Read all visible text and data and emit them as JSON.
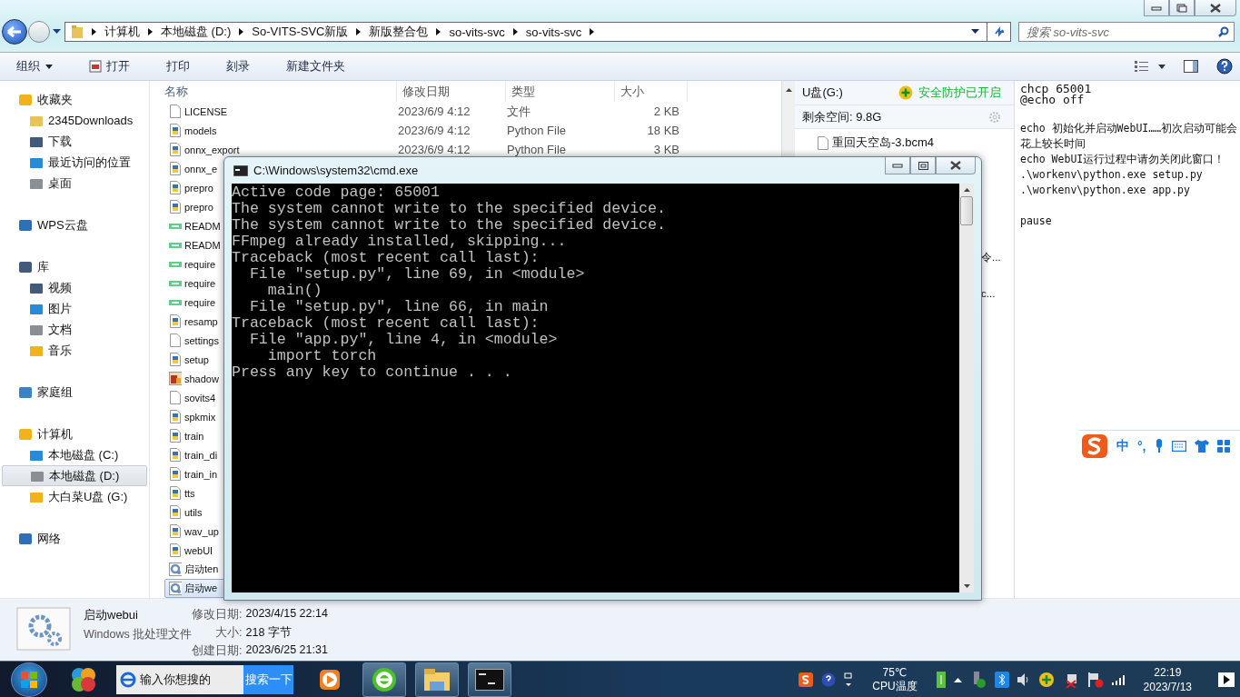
{
  "address_bar": {
    "crumbs": [
      "计算机",
      "本地磁盘 (D:)",
      "So-VITS-SVC新版",
      "新版整合包",
      "so-vits-svc",
      "so-vits-svc"
    ]
  },
  "search": {
    "placeholder": "搜索 so-vits-svc"
  },
  "toolbar": {
    "items": [
      {
        "label": "组织",
        "kind": "menu"
      },
      {
        "label": "打开",
        "kind": "icon"
      },
      {
        "label": "打印",
        "kind": "plain"
      },
      {
        "label": "刻录",
        "kind": "plain"
      },
      {
        "label": "新建文件夹",
        "kind": "plain"
      }
    ]
  },
  "nav": {
    "groups": [
      {
        "label": "收藏夹",
        "selected": false,
        "children": [
          {
            "label": "2345Downloads",
            "selected": false
          },
          {
            "label": "下载",
            "selected": false
          },
          {
            "label": "最近访问的位置",
            "selected": false
          },
          {
            "label": "桌面",
            "selected": false
          }
        ]
      },
      {
        "label": "WPS云盘",
        "selected": false
      },
      {
        "label": "库",
        "selected": false,
        "children": [
          {
            "label": "视频",
            "selected": false
          },
          {
            "label": "图片",
            "selected": false
          },
          {
            "label": "文档",
            "selected": false
          },
          {
            "label": "音乐",
            "selected": false
          }
        ]
      },
      {
        "label": "家庭组",
        "selected": false
      },
      {
        "label": "计算机",
        "selected": false,
        "children": [
          {
            "label": "本地磁盘 (C:)",
            "selected": false
          },
          {
            "label": "本地磁盘 (D:)",
            "selected": true
          },
          {
            "label": "大白菜U盘 (G:)",
            "selected": false
          }
        ]
      },
      {
        "label": "网络",
        "selected": false
      }
    ]
  },
  "file_list": {
    "columns": [
      "名称",
      "修改日期",
      "类型",
      "大小"
    ],
    "rows": [
      {
        "name": "LICENSE",
        "date": "2023/6/9 4:12",
        "type": "文件",
        "size": "2 KB",
        "kind": "blank",
        "selected": false
      },
      {
        "name": "models",
        "date": "2023/6/9 4:12",
        "type": "Python File",
        "size": "18 KB",
        "kind": "python",
        "selected": false
      },
      {
        "name": "onnx_export",
        "date": "2023/6/9 4:12",
        "type": "Python File",
        "size": "3 KB",
        "kind": "python",
        "selected": false
      },
      {
        "name": "onnx_e",
        "kind": "python",
        "selected": false
      },
      {
        "name": "prepro",
        "kind": "python",
        "selected": false
      },
      {
        "name": "prepro",
        "kind": "python",
        "selected": false
      },
      {
        "name": "READM",
        "kind": "text",
        "selected": false
      },
      {
        "name": "READM",
        "kind": "text",
        "selected": false
      },
      {
        "name": "require",
        "kind": "text",
        "selected": false
      },
      {
        "name": "require",
        "kind": "text",
        "selected": false
      },
      {
        "name": "require",
        "kind": "text",
        "selected": false
      },
      {
        "name": "resamp",
        "kind": "python",
        "selected": false
      },
      {
        "name": "settings",
        "kind": "blank",
        "selected": false
      },
      {
        "name": "setup",
        "kind": "python",
        "selected": false
      },
      {
        "name": "shadow",
        "kind": "image",
        "selected": false
      },
      {
        "name": "sovits4",
        "kind": "blank",
        "selected": false
      },
      {
        "name": "spkmix",
        "kind": "python",
        "selected": false
      },
      {
        "name": "train",
        "kind": "python",
        "selected": false
      },
      {
        "name": "train_di",
        "kind": "python",
        "selected": false
      },
      {
        "name": "train_in",
        "kind": "python",
        "selected": false
      },
      {
        "name": "tts",
        "kind": "python",
        "selected": false
      },
      {
        "name": "utils",
        "kind": "python",
        "selected": false
      },
      {
        "name": "wav_up",
        "kind": "python",
        "selected": false
      },
      {
        "name": "webUI",
        "kind": "python",
        "selected": false
      },
      {
        "name": "启动ten",
        "kind": "batch",
        "selected": false
      },
      {
        "name": "启动we",
        "kind": "batch",
        "selected": true
      }
    ]
  },
  "drive_panel": {
    "title": "U盘(G:)",
    "status": "安全防护已开启",
    "free_space": "剩余空间: 9.8G",
    "files": [
      "重回天空岛-3.bcm4"
    ],
    "fragments": [
      "令...",
      "c..."
    ]
  },
  "preview": {
    "lines": [
      {
        "text": "chcp 65001",
        "kind": "large",
        "blank_before": false
      },
      {
        "text": "@echo off",
        "kind": "large",
        "blank_before": false
      },
      {
        "text": "echo 初始化并启动WebUI……初次启动可能会花上较长时间",
        "kind": "small",
        "blank_before": true
      },
      {
        "text": "echo WebUI运行过程中请勿关闭此窗口！",
        "kind": "small",
        "blank_before": false
      },
      {
        "text": ".\\workenv\\python.exe setup.py",
        "kind": "small",
        "blank_before": false
      },
      {
        "text": ".\\workenv\\python.exe app.py",
        "kind": "small",
        "blank_before": false
      },
      {
        "text": "pause",
        "kind": "small",
        "blank_before": true
      }
    ]
  },
  "cmd": {
    "title": "C:\\Windows\\system32\\cmd.exe",
    "lines": [
      "Active code page: 65001",
      "The system cannot write to the specified device.",
      "The system cannot write to the specified device.",
      "FFmpeg already installed, skipping...",
      "Traceback (most recent call last):",
      "  File \"setup.py\", line 69, in <module>",
      "    main()",
      "  File \"setup.py\", line 66, in main",
      "Traceback (most recent call last):",
      "  File \"app.py\", line 4, in <module>",
      "    import torch",
      "Press any key to continue . . ."
    ]
  },
  "ime": {
    "label": "中",
    "punctuation": "°,"
  },
  "details": {
    "name": "启动webui",
    "type": "Windows 批处理文件",
    "fields": [
      {
        "label": "修改日期:",
        "value": "2023/4/15 22:14"
      },
      {
        "label": "大小:",
        "value": "218 字节"
      },
      {
        "label": "创建日期:",
        "value": "2023/6/25 21:31"
      }
    ]
  },
  "taskbar": {
    "search_placeholder": "输入你想搜的",
    "search_button": "搜索一下",
    "temperature": "75℃",
    "temperature_label": "CPU温度",
    "time": "22:19",
    "date": "2023/7/13"
  }
}
